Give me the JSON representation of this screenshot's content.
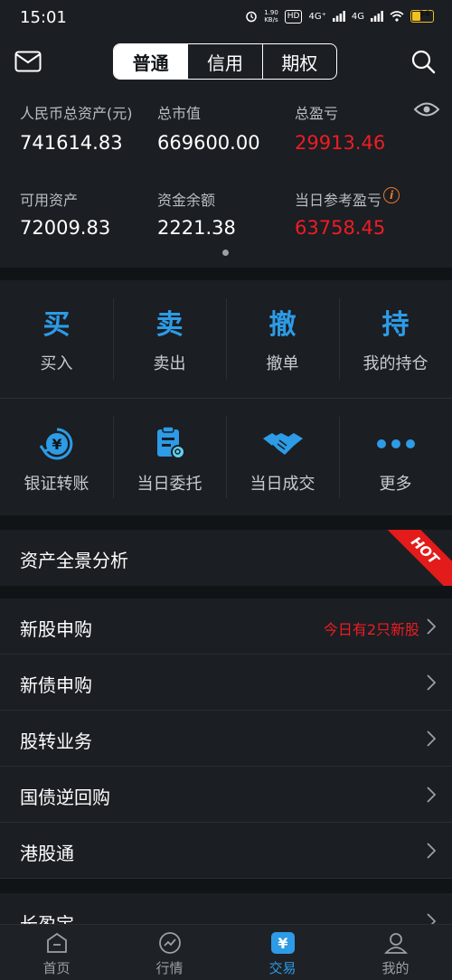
{
  "status_bar": {
    "time": "15:01",
    "net_speed": "1.90\nKB/s",
    "hd": "HD",
    "sig1": "4G⁺",
    "sig2": "4G",
    "battery": "34"
  },
  "header": {
    "tabs": [
      "普通",
      "信用",
      "期权"
    ]
  },
  "assets": {
    "total_assets_label": "人民币总资产(元)",
    "total_assets_value": "741614.83",
    "market_value_label": "总市值",
    "market_value_value": "669600.00",
    "total_pl_label": "总盈亏",
    "total_pl_value": "29913.46",
    "available_label": "可用资产",
    "available_value": "72009.83",
    "cash_label": "资金余额",
    "cash_value": "2221.38",
    "daily_pl_label": "当日参考盈亏",
    "daily_pl_value": "63758.45",
    "info_glyph": "i"
  },
  "actions_row1": [
    {
      "char": "买",
      "label": "买入"
    },
    {
      "char": "卖",
      "label": "卖出"
    },
    {
      "char": "撤",
      "label": "撤单"
    },
    {
      "char": "持",
      "label": "我的持仓"
    }
  ],
  "actions_row2": [
    {
      "icon": "yen-transfer-icon",
      "label": "银证转账"
    },
    {
      "icon": "order-list-icon",
      "label": "当日委托"
    },
    {
      "icon": "handshake-icon",
      "label": "当日成交"
    },
    {
      "icon": "more-dots-icon",
      "label": "更多"
    }
  ],
  "panorama": {
    "title": "资产全景分析",
    "badge": "HOT"
  },
  "list": [
    {
      "label": "新股申购",
      "note": "今日有2只新股"
    },
    {
      "label": "新债申购",
      "note": ""
    },
    {
      "label": "股转业务",
      "note": ""
    },
    {
      "label": "国债逆回购",
      "note": ""
    },
    {
      "label": "港股通",
      "note": ""
    }
  ],
  "partial_item": {
    "label": "长盈宝"
  },
  "tabbar": [
    {
      "icon": "home-icon",
      "label": "首页"
    },
    {
      "icon": "market-icon",
      "label": "行情"
    },
    {
      "icon": "trade-icon",
      "label": "交易",
      "active": true,
      "glyph": "¥"
    },
    {
      "icon": "profile-icon",
      "label": "我的"
    }
  ],
  "colors": {
    "accent": "#2d9be6",
    "loss_red": "#ee1c25",
    "background": "#111417",
    "panel": "#1b1e22"
  }
}
